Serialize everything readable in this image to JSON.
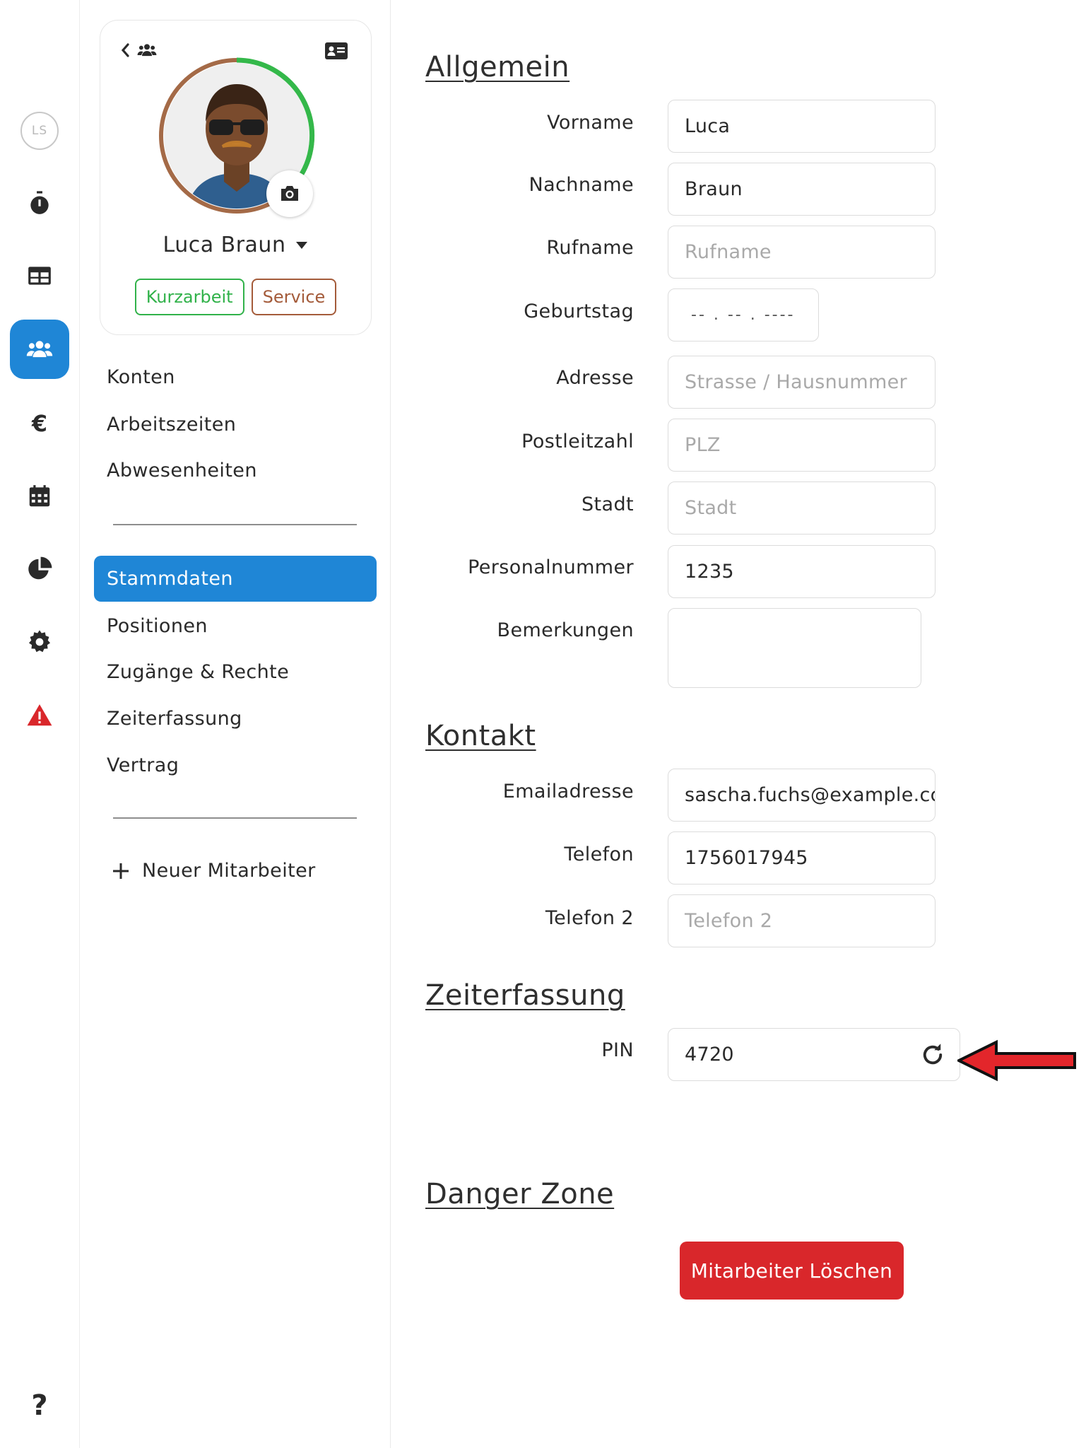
{
  "rail": {
    "user_initials": "LS",
    "items": [
      "stopwatch-icon",
      "table-icon",
      "users-icon",
      "euro-icon",
      "calendar-icon",
      "pie-chart-icon",
      "gear-icon",
      "warning-icon"
    ],
    "help_label": "?"
  },
  "profile": {
    "name": "Luca Braun",
    "tags": [
      "Kurzarbeit",
      "Service"
    ]
  },
  "nav": {
    "top_links": [
      "Konten",
      "Arbeitszeiten",
      "Abwesenheiten"
    ],
    "active": "Stammdaten",
    "links": [
      "Positionen",
      "Zugänge & Rechte",
      "Zeiterfassung",
      "Vertrag"
    ],
    "new_employee": "Neuer Mitarbeiter"
  },
  "allgemein": {
    "title": "Allgemein",
    "vorname_label": "Vorname",
    "vorname_value": "Luca",
    "nachname_label": "Nachname",
    "nachname_value": "Braun",
    "rufname_label": "Rufname",
    "rufname_placeholder": "Rufname",
    "geburtstag_label": "Geburtstag",
    "geburtstag_placeholder": "-- . -- . ----",
    "adresse_label": "Adresse",
    "adresse_placeholder": "Strasse / Hausnummer",
    "plz_label": "Postleitzahl",
    "plz_placeholder": "PLZ",
    "stadt_label": "Stadt",
    "stadt_placeholder": "Stadt",
    "personalnummer_label": "Personalnummer",
    "personalnummer_value": "1235",
    "bemerkungen_label": "Bemerkungen",
    "bemerkungen_value": ""
  },
  "kontakt": {
    "title": "Kontakt",
    "email_label": "Emailadresse",
    "email_value": "sascha.fuchs@example.cc",
    "telefon_label": "Telefon",
    "telefon_value": "1756017945",
    "telefon2_label": "Telefon 2",
    "telefon2_placeholder": "Telefon 2"
  },
  "zeiterfassung": {
    "title": "Zeiterfassung",
    "pin_label": "PIN",
    "pin_value": "4720"
  },
  "danger": {
    "title": "Danger Zone",
    "delete_button": "Mitarbeiter Löschen"
  },
  "colors": {
    "primary": "#1f86d6",
    "danger": "#d9272b",
    "tag_green": "#31b24a",
    "tag_brown": "#a45b3a",
    "arrow": "#e3262b"
  }
}
